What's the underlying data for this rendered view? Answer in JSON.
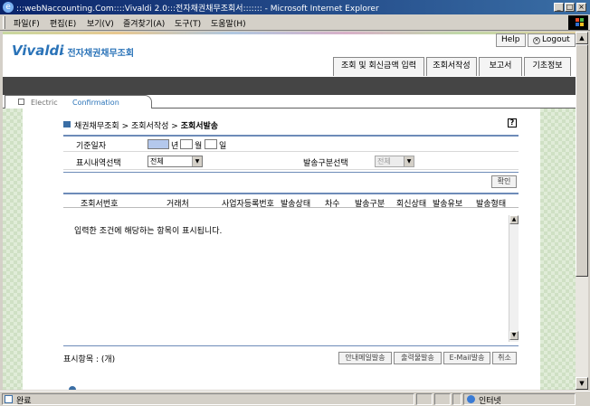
{
  "window": {
    "title": ":::webNaccounting.Com::::Vivaldi 2.0:::전자채권채무조회서::::::: - Microsoft Internet Explorer"
  },
  "menu": {
    "items": [
      "파일(F)",
      "편집(E)",
      "보기(V)",
      "즐겨찾기(A)",
      "도구(T)",
      "도움말(H)"
    ]
  },
  "header": {
    "brand": "Vivaldi",
    "brand_sub": "– 전자채권채무조회",
    "help_label": "Help",
    "logout_label": "Logout",
    "nav_tabs": [
      "조회 및 회신금액 입력",
      "조회서작성",
      "보고서",
      "기초정보"
    ],
    "subtab_left": "Electric",
    "subtab_right": "Confirmation"
  },
  "breadcrumb": {
    "part1": "채권채무조회",
    "part2": "조회서작성",
    "current": "조회서발송",
    "sep": ">"
  },
  "help_icon": "?",
  "form": {
    "date_label": "기준일자",
    "year_unit": "년",
    "month_unit": "월",
    "day_unit": "일",
    "display_label": "표시내역선택",
    "display_value": "전체",
    "send_type_label": "발송구분선택",
    "send_type_value": "전체",
    "confirm_label": "확인"
  },
  "table": {
    "columns": [
      "조회서번호",
      "거래처",
      "사업자등록번호",
      "발송상태",
      "차수",
      "발송구분",
      "회신상태",
      "발송유보",
      "발송형태"
    ],
    "empty_message": "입력한 조건에 해당하는 항목이 표시됩니다."
  },
  "footer": {
    "count_label": "표시항목 : (개)",
    "buttons": [
      "안내메일발송",
      "출력물발송",
      "E-Mail발송",
      "취소"
    ]
  },
  "status": {
    "left": "완료",
    "zone": "인터넷"
  },
  "colors": {
    "titlebar": "#0a246a",
    "brand": "#2a73b8",
    "dark_bar": "#454545",
    "accent_line": "#6d8bb8"
  }
}
